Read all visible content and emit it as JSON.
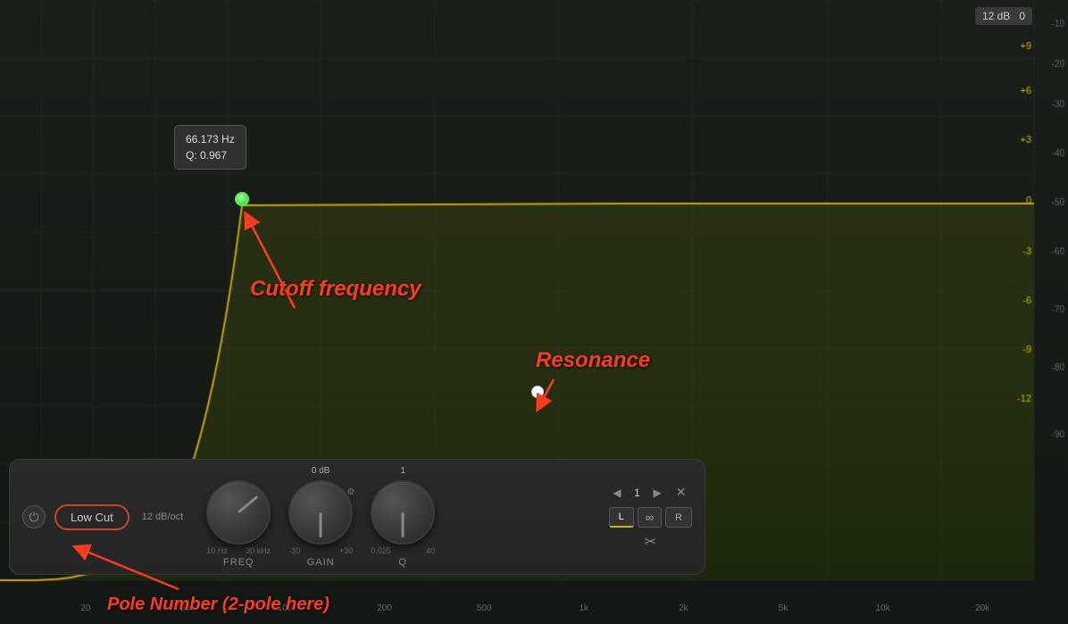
{
  "dB_badge": "12 dB",
  "dB_badge_zero": "0",
  "right_scale": [
    "+9",
    "-10",
    "+6",
    "-20",
    "+3",
    "-30",
    "0",
    "-40",
    "-3",
    "-50",
    "-6",
    "-60",
    "-9",
    "-70",
    "-12",
    "-80",
    "",
    "-90"
  ],
  "right_scale_yellow": [
    "+9",
    "+6",
    "+3",
    "0",
    "-3",
    "-6",
    "-9",
    "-12"
  ],
  "right_scale_dark": [
    "-10",
    "-20",
    "-30",
    "-40",
    "-50",
    "-60",
    "-70",
    "-80",
    "-90"
  ],
  "tooltip": {
    "freq": "66.173 Hz",
    "q": "Q: 0.967"
  },
  "annotations": {
    "cutoff": "Cutoff frequency",
    "resonance": "Resonance",
    "pole": "Pole Number (2-pole here)"
  },
  "panel": {
    "filter_type": "Low Cut",
    "db_oct": "12 dB/oct",
    "freq_label": "FREQ",
    "freq_min": "10 Hz",
    "freq_max": "30 kHz",
    "gain_label": "GAIN",
    "gain_min": "-30",
    "gain_max": "+30",
    "gain_center": "0 dB",
    "q_label": "Q",
    "q_min": "0.025",
    "q_max": "40",
    "q_center": "1",
    "nav_prev": "◀",
    "nav_num": "1",
    "nav_next": "▶",
    "close": "✕",
    "lr_L": "L",
    "lr_link": "∞",
    "lr_R": "R"
  },
  "bottom_axis": [
    "20",
    "50",
    "100",
    "200",
    "500",
    "1k",
    "2k",
    "5k",
    "10k",
    "20k"
  ]
}
